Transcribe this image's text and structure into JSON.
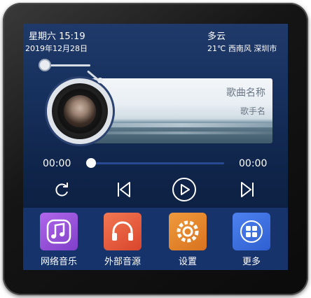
{
  "status": {
    "weekday_time": "星期六 15:19",
    "date": "2019年12月28日",
    "weather": "多云",
    "weather_detail": "21℃ 西南风 深圳市"
  },
  "now_playing": {
    "title": "歌曲名称",
    "artist": "歌手名"
  },
  "progress": {
    "current": "00:00",
    "total": "00:00",
    "fraction": 0
  },
  "controls": {
    "icons": [
      "repeat-icon",
      "previous-icon",
      "play-icon",
      "next-icon"
    ]
  },
  "apps": [
    {
      "label": "网络音乐",
      "icon": "music-note-icon",
      "color": "#9b4fd8"
    },
    {
      "label": "外部音源",
      "icon": "headphones-icon",
      "color": "#e8613f"
    },
    {
      "label": "设置",
      "icon": "gear-icon",
      "color": "#e78a2e"
    },
    {
      "label": "更多",
      "icon": "grid-icon",
      "color": "#3a6fe0"
    }
  ],
  "colors": {
    "screen_bg": "#16305d",
    "dock_bg": "#17336b",
    "progress_track": "#274a93"
  }
}
